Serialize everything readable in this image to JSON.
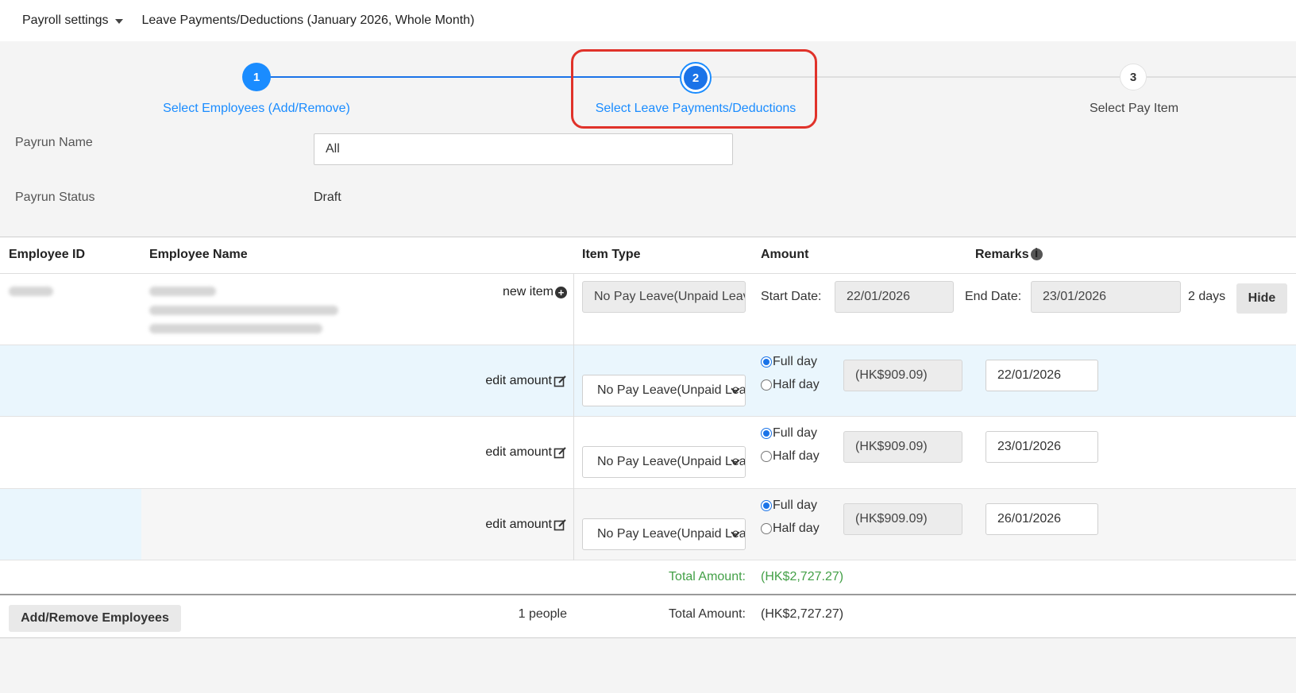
{
  "topbar": {
    "menu_label": "Payroll settings",
    "breadcrumb": "Leave Payments/Deductions (January 2026, Whole Month)"
  },
  "stepper": {
    "steps": [
      {
        "number": "1",
        "label": "Select Employees (Add/Remove)",
        "state": "completed"
      },
      {
        "number": "2",
        "label": "Select Leave Payments/Deductions",
        "state": "current"
      },
      {
        "number": "3",
        "label": "Select Pay Item",
        "state": "pending"
      }
    ],
    "active_color": "#1a8cff",
    "highlight_color": "#e0322a"
  },
  "form": {
    "payrun_name_label": "Payrun Name",
    "payrun_name_value": "All",
    "payrun_status_label": "Payrun Status",
    "payrun_status_value": "Draft"
  },
  "table": {
    "headers": {
      "employee_id": "Employee ID",
      "employee_name": "Employee Name",
      "item_type": "Item Type",
      "amount": "Amount",
      "remarks": "Remarks"
    },
    "new_item_label": "new item",
    "main_row": {
      "item_type": "No Pay Leave(Unpaid Leave)",
      "start_date_label": "Start Date:",
      "start_date": "22/01/2026",
      "end_date_label": "End Date:",
      "end_date": "23/01/2026",
      "days": "2 days",
      "hide_label": "Hide"
    },
    "detail_rows": [
      {
        "action_label": "edit amount",
        "item_type": "No Pay Leave(Unpaid Leave)",
        "full_day_label": "Full day",
        "half_day_label": "Half day",
        "selected": "full",
        "amount": "(HK$909.09)",
        "remark_date": "22/01/2026"
      },
      {
        "action_label": "edit amount",
        "item_type": "No Pay Leave(Unpaid Leave)",
        "full_day_label": "Full day",
        "half_day_label": "Half day",
        "selected": "full",
        "amount": "(HK$909.09)",
        "remark_date": "23/01/2026"
      },
      {
        "action_label": "edit amount",
        "item_type": "No Pay Leave(Unpaid Leave)",
        "full_day_label": "Full day",
        "half_day_label": "Half day",
        "selected": "full",
        "amount": "(HK$909.09)",
        "remark_date": "26/01/2026"
      }
    ],
    "subtotal_label": "Total Amount:",
    "subtotal_value": "(HK$2,727.27)",
    "subtotal_color": "#43a047"
  },
  "footer": {
    "add_remove_label": "Add/Remove Employees",
    "people_count": "1 people",
    "total_label": "Total Amount:",
    "total_value": "(HK$2,727.27)"
  }
}
